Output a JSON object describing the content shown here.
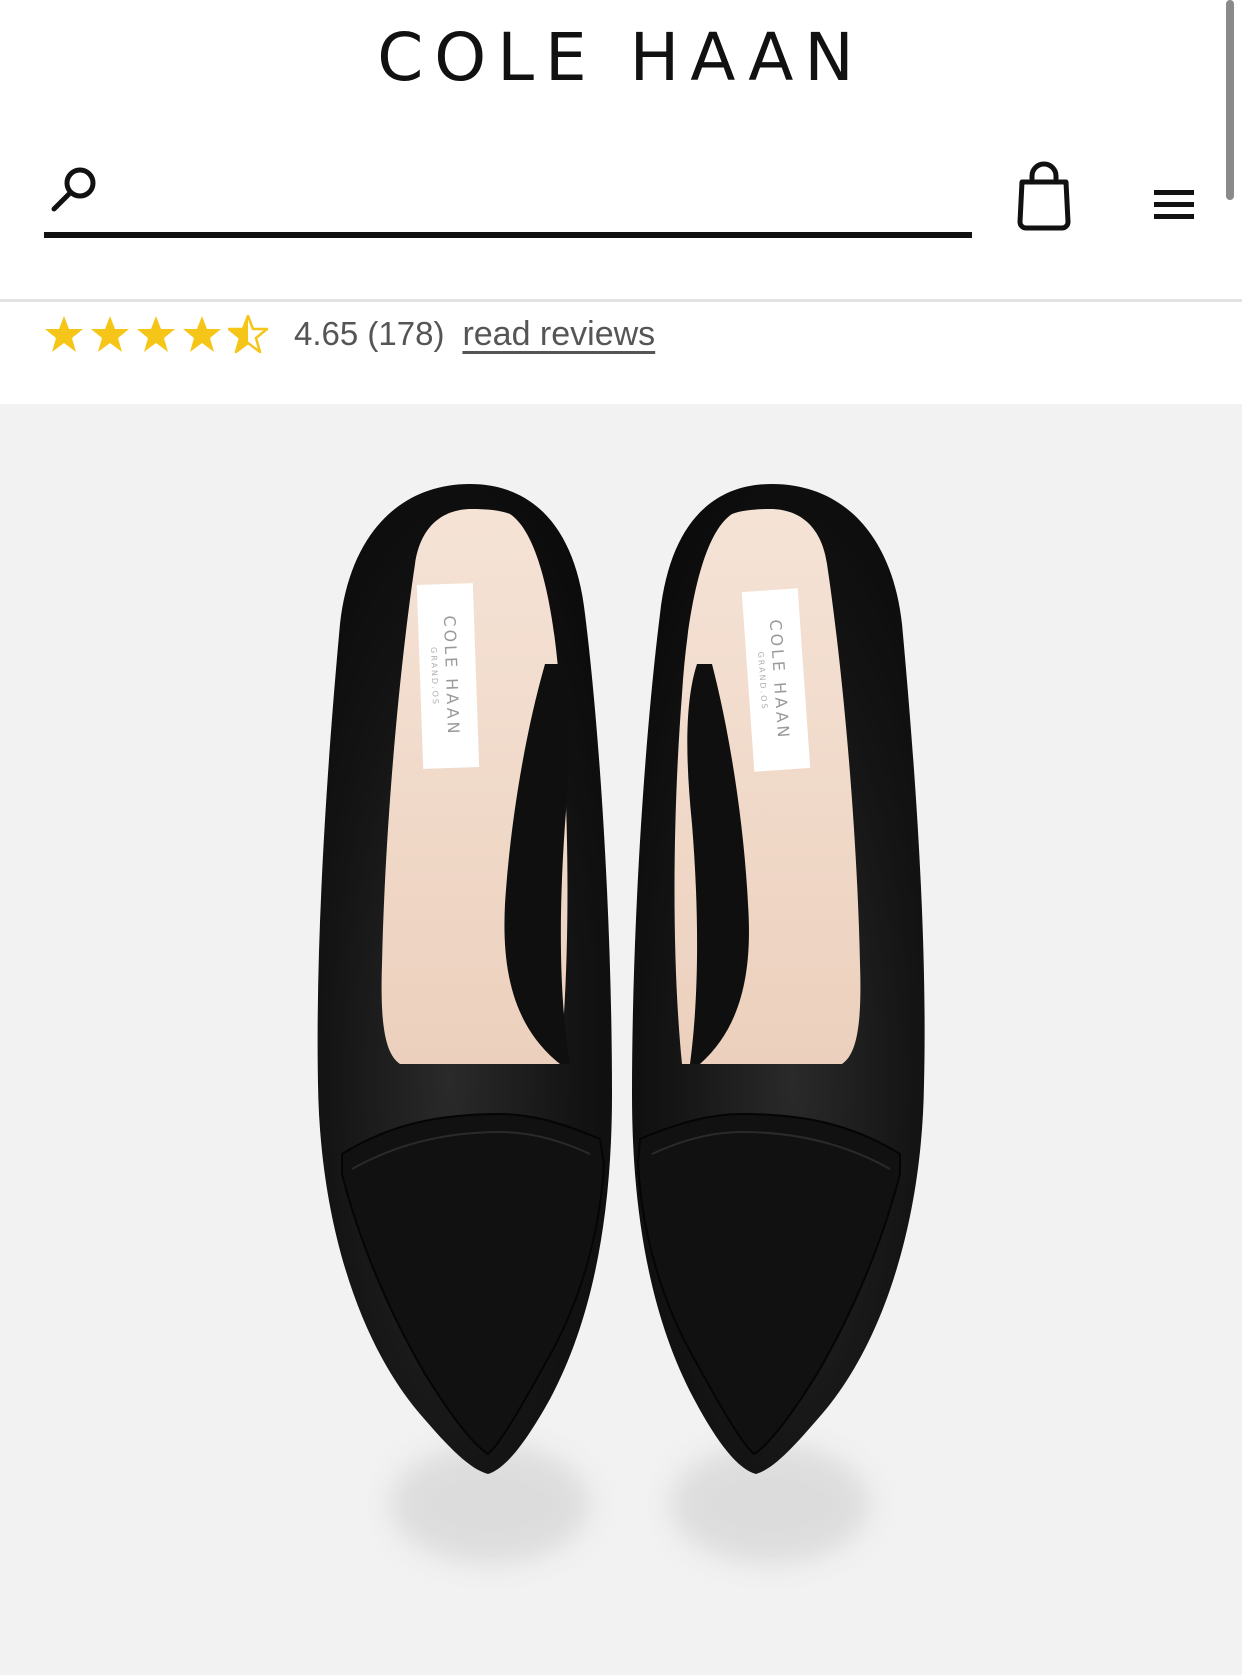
{
  "header": {
    "brand": "COLE HAAN",
    "search": {
      "value": "",
      "placeholder": ""
    },
    "icons": {
      "search": "search-icon",
      "bag": "shopping-bag-icon",
      "menu": "hamburger-menu-icon"
    }
  },
  "rating": {
    "stars_value": 4.65,
    "stars_max": 5,
    "summary": "4.65 (178)",
    "read_reviews_label": "read reviews"
  },
  "product_image": {
    "shoe_labels": [
      "COLE HAAN",
      "COLE HAAN"
    ],
    "shoe_sublabels": [
      "GRAND.OS",
      "GRAND.OS"
    ]
  },
  "colors": {
    "star": "#f5c518",
    "text": "#111111",
    "muted": "#555555",
    "image_bg": "#f2f2f2",
    "shoe_leather": "#141414",
    "shoe_lining": "#f1d8c6"
  }
}
